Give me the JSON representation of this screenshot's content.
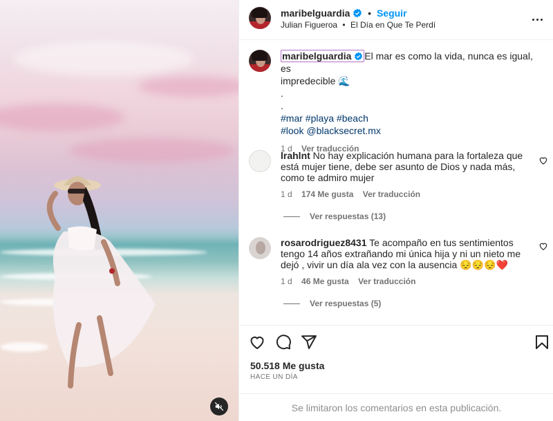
{
  "media": {
    "mute_icon": "speaker-muted-icon"
  },
  "header": {
    "username": "maribelguardia",
    "separator": "•",
    "follow_label": "Seguir",
    "audio_artist": "Julian Figueroa",
    "audio_dot": "•",
    "audio_track": "El Día en Que Te Perdí",
    "verified_color": "#0095f6"
  },
  "caption": {
    "username": "maribelguardia",
    "text_line1": "El mar es como la vida, nunca es igual, es",
    "text_line2": "impredecible 🌊",
    "dot1": ".",
    "dot2": ".",
    "hashtags_line1": "#mar #playa #beach",
    "hashtags_line2": "#look @blacksecret.mx",
    "time": "1 d",
    "translate": "Ver traducción"
  },
  "comments": [
    {
      "username": "lrahlnt",
      "text": "No hay explicación humana para la fortaleza que está mujer tiene, debe ser asunto de Dios y nada más, como te admiro mujer",
      "time": "1 d",
      "likes": "174 Me gusta",
      "translate": "Ver traducción",
      "replies": "Ver respuestas (13)"
    },
    {
      "username": "rosarodriguez8431",
      "text": "Te acompaño en tus sentimientos tengo 14 años extrañando mi única hija y ni un nieto me dejó , vivir un día ala vez con la ausencia 😔😔😔❤️",
      "time": "1 d",
      "likes": "46 Me gusta",
      "translate": "Ver traducción",
      "replies": "Ver respuestas (5)"
    }
  ],
  "footer": {
    "likes": "50.518 Me gusta",
    "time_ago": "HACE UN DÍA",
    "comments_limited": "Se limitaron los comentarios en esta publicación."
  }
}
